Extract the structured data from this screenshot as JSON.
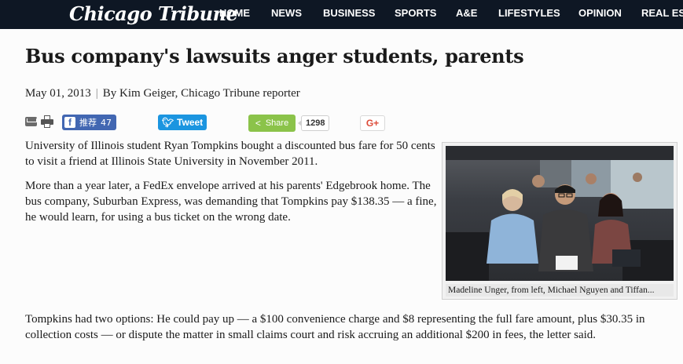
{
  "site": {
    "logo": "Chicago Tribune",
    "nav": [
      "HOME",
      "NEWS",
      "BUSINESS",
      "SPORTS",
      "A&E",
      "LIFESTYLES",
      "OPINION",
      "REAL ES"
    ]
  },
  "article": {
    "headline": "Bus company's lawsuits anger students, parents",
    "date": "May 01, 2013",
    "separator": "|",
    "byline": "By Kim Geiger, Chicago Tribune reporter",
    "paragraphs": [
      "University of Illinois student Ryan Tompkins bought a discounted bus fare for 50 cents to visit a friend at Illinois State University in November 2011.",
      "More than a year later, a FedEx envelope arrived at his parents' Edgebrook home. The bus company, Suburban Express, was demanding that Tompkins pay $138.35 — a fine, he would learn, for using a bus ticket on the wrong date.",
      "Tompkins had two options: He could pay up — a $100 convenience charge and $8 representing the full fare amount, plus $30.35 in collection costs — or dispute the matter in small claims court and risk accruing an additional $200 in fees, the letter said."
    ],
    "photo_caption": "Madeline Unger, from left, Michael Nguyen and Tiffan..."
  },
  "share": {
    "facebook_label": "推荐",
    "facebook_count": "47",
    "twitter_label": "Tweet",
    "share_label": "Share",
    "share_count": "1298",
    "gplus_label": "G+"
  },
  "colors": {
    "topbar": "#0e1724",
    "facebook": "#4267b2",
    "twitter": "#1b95e0",
    "share": "#8bc34a",
    "gplus": "#dd4b39"
  },
  "icons": {
    "mail": "mail-icon",
    "print": "print-icon",
    "facebook": "facebook-icon",
    "twitter": "twitter-bird-icon",
    "share": "share-icon"
  }
}
